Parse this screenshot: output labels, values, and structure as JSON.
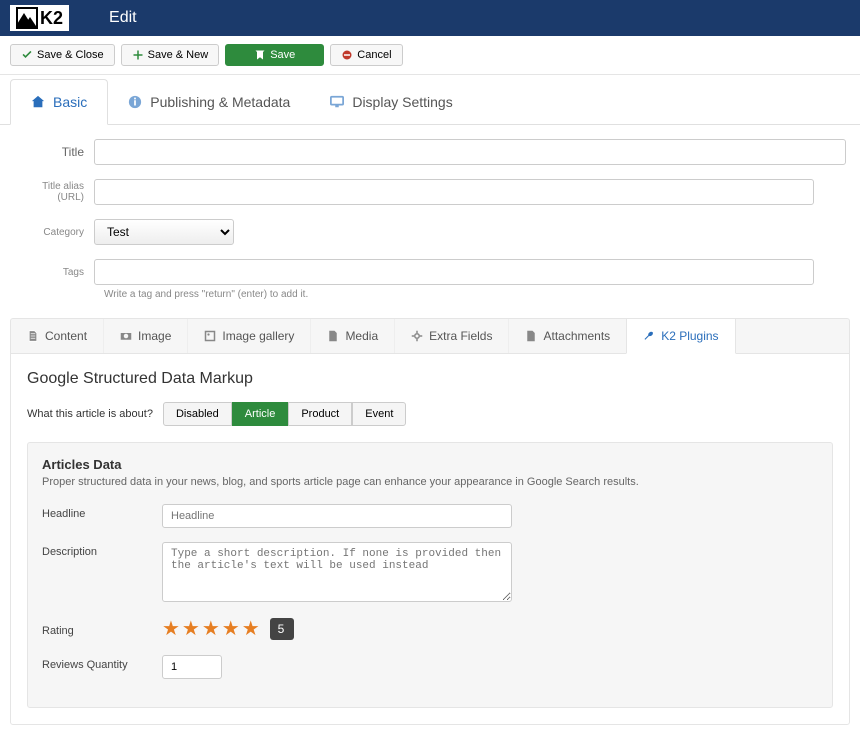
{
  "header": {
    "logo_text": "K2",
    "title": "Edit"
  },
  "toolbar": {
    "save_close": "Save & Close",
    "save_new": "Save & New",
    "save": "Save",
    "cancel": "Cancel"
  },
  "main_tabs": {
    "basic": "Basic",
    "publishing": "Publishing & Metadata",
    "display": "Display Settings"
  },
  "form": {
    "title_label": "Title",
    "alias_label": "Title alias (URL)",
    "category_label": "Category",
    "category_value": "Test",
    "tags_label": "Tags",
    "tags_hint": "Write a tag and press \"return\" (enter) to add it."
  },
  "subtabs": {
    "content": "Content",
    "image": "Image",
    "gallery": "Image gallery",
    "media": "Media",
    "extra": "Extra Fields",
    "attachments": "Attachments",
    "plugins": "K2 Plugins"
  },
  "plugin": {
    "title": "Google Structured Data Markup",
    "modes_label": "What this article is about?",
    "modes": {
      "disabled": "Disabled",
      "article": "Article",
      "product": "Product",
      "event": "Event"
    },
    "panel_title": "Articles Data",
    "panel_desc": "Proper structured data in your news, blog, and sports article page can enhance your appearance in Google Search results.",
    "headline_label": "Headline",
    "headline_placeholder": "Headline",
    "description_label": "Description",
    "description_placeholder": "Type a short description. If none is provided then the article's text will be used instead",
    "rating_label": "Rating",
    "rating_value": "5",
    "reviews_label": "Reviews Quantity",
    "reviews_value": "1"
  }
}
